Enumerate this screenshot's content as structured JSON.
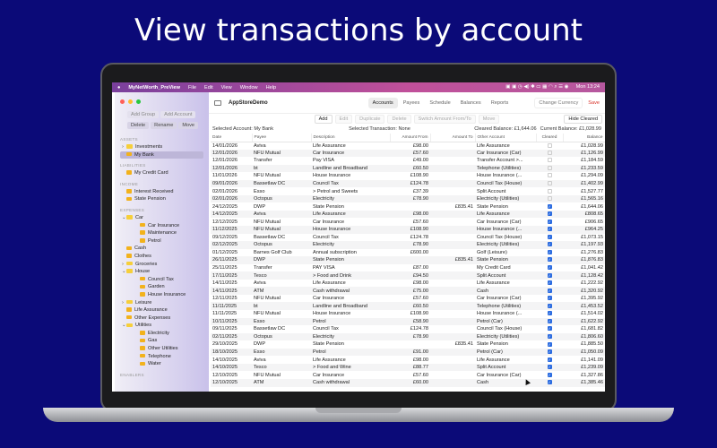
{
  "headline": "View transactions by account",
  "menubar": {
    "app": "MyNetWorth_PreView",
    "items": [
      "File",
      "Edit",
      "View",
      "Window",
      "Help"
    ],
    "clock": "Mon 13:24"
  },
  "sidebar": {
    "buttons": [
      "Add Group",
      "Add Account",
      "Delete",
      "Rename",
      "Move"
    ],
    "sections": [
      {
        "label": "ASSETS",
        "items": [
          {
            "label": "Investments",
            "type": "folder",
            "chev": ">",
            "depth": 0
          },
          {
            "label": "My Bank",
            "type": "account",
            "depth": 0,
            "selected": true
          }
        ]
      },
      {
        "label": "LIABILITIES",
        "items": [
          {
            "label": "My Credit Card",
            "type": "account",
            "depth": 0
          }
        ]
      },
      {
        "label": "INCOME",
        "items": [
          {
            "label": "Interest Received",
            "type": "account",
            "depth": 0
          },
          {
            "label": "State Pension",
            "type": "account",
            "depth": 0
          }
        ]
      },
      {
        "label": "EXPENSES",
        "items": [
          {
            "label": "Car",
            "type": "folder",
            "chev": "v",
            "depth": 0
          },
          {
            "label": "Car Insurance",
            "type": "account",
            "depth": 1
          },
          {
            "label": "Maintenance",
            "type": "account",
            "depth": 1
          },
          {
            "label": "Petrol",
            "type": "account",
            "depth": 1
          },
          {
            "label": "Cash",
            "type": "account",
            "depth": 0
          },
          {
            "label": "Clothes",
            "type": "account",
            "depth": 0
          },
          {
            "label": "Groceries",
            "type": "folder",
            "chev": ">",
            "depth": 0
          },
          {
            "label": "House",
            "type": "folder",
            "chev": "v",
            "depth": 0
          },
          {
            "label": "Council Tax",
            "type": "account",
            "depth": 1
          },
          {
            "label": "Garden",
            "type": "account",
            "depth": 1
          },
          {
            "label": "House Insurance",
            "type": "account",
            "depth": 1
          },
          {
            "label": "Leisure",
            "type": "folder",
            "chev": ">",
            "depth": 0
          },
          {
            "label": "Life Assurance",
            "type": "account",
            "depth": 0
          },
          {
            "label": "Other Expenses",
            "type": "account",
            "depth": 0
          },
          {
            "label": "Utilities",
            "type": "folder",
            "chev": "v",
            "depth": 0
          },
          {
            "label": "Electricity",
            "type": "account",
            "depth": 1
          },
          {
            "label": "Gas",
            "type": "account",
            "depth": 1
          },
          {
            "label": "Other Utilities",
            "type": "account",
            "depth": 1
          },
          {
            "label": "Telephone",
            "type": "account",
            "depth": 1
          },
          {
            "label": "Water",
            "type": "account",
            "depth": 1
          }
        ]
      },
      {
        "label": "ENABLERS",
        "items": []
      }
    ]
  },
  "toolbar": {
    "title": "AppStoreDemo",
    "tabs": [
      "Accounts",
      "Payees",
      "Schedule",
      "Balances",
      "Reports"
    ],
    "active_tab": "Accounts",
    "change_currency": "Change Currency",
    "save": "Save"
  },
  "actions": {
    "buttons": [
      "Add",
      "Edit",
      "Duplicate",
      "Delete",
      "Switch Amount From/To",
      "Move"
    ],
    "hide_cleared": "Hide Cleared"
  },
  "info": {
    "selected_account": "Selected Account:  My Bank",
    "selected_transaction": "Selected Transaction:  None",
    "cleared_balance": "Cleared Balance:  £1,644.06",
    "current_balance": "Current Balance:  £1,028.99"
  },
  "table": {
    "columns": [
      "Date",
      "Payee",
      "Description",
      "Amount From",
      "Amount To",
      "Other Account",
      "Cleared",
      "Balance"
    ],
    "rows": [
      [
        "14/01/2026",
        "Aviva",
        "Life Assurance",
        "£98.00",
        "",
        "Life Assurance",
        false,
        "£1,028.99"
      ],
      [
        "12/01/2026",
        "NFU Mutual",
        "Car Insurance",
        "£57.60",
        "",
        "Car Insurance (Car)",
        false,
        "£1,126.99"
      ],
      [
        "12/01/2026",
        "Transfer",
        "Pay VISA",
        "£49.00",
        "",
        "Transfer Account >...",
        false,
        "£1,184.59"
      ],
      [
        "12/01/2026",
        "bt",
        "Landline and Broadband",
        "£60.50",
        "",
        "Telephone (Utilities)",
        false,
        "£1,233.59"
      ],
      [
        "11/01/2026",
        "NFU Mutual",
        "House Insurance",
        "£108.90",
        "",
        "House Insurance (...",
        false,
        "£1,294.09"
      ],
      [
        "09/01/2026",
        "Bassetlaw DC",
        "Council Tax",
        "£124.78",
        "",
        "Council Tax (House)",
        false,
        "£1,402.99"
      ],
      [
        "02/01/2026",
        "Esso",
        "> Petrol and Sweets",
        "£37.39",
        "",
        "Split Account",
        false,
        "£1,527.77"
      ],
      [
        "02/01/2026",
        "Octopus",
        "Electricity",
        "£78.90",
        "",
        "Electricity (Utilities)",
        false,
        "£1,565.16"
      ],
      [
        "24/12/2025",
        "DWP",
        "State Pension",
        "",
        "£835.41",
        "State Pension",
        true,
        "£1,644.06"
      ],
      [
        "14/12/2025",
        "Aviva",
        "Life Assurance",
        "£98.00",
        "",
        "Life Assurance",
        true,
        "£808.65"
      ],
      [
        "12/12/2025",
        "NFU Mutual",
        "Car Insurance",
        "£57.60",
        "",
        "Car Insurance (Car)",
        true,
        "£906.65"
      ],
      [
        "11/12/2025",
        "NFU Mutual",
        "House Insurance",
        "£108.90",
        "",
        "House Insurance (...",
        true,
        "£964.25"
      ],
      [
        "09/12/2025",
        "Bassetlaw DC",
        "Council Tax",
        "£124.78",
        "",
        "Council Tax (House)",
        true,
        "£1,073.15"
      ],
      [
        "02/12/2025",
        "Octopus",
        "Electricity",
        "£78.90",
        "",
        "Electricity (Utilities)",
        true,
        "£1,197.93"
      ],
      [
        "01/12/2025",
        "Barnes Golf Club",
        "Annual subscription",
        "£600.00",
        "",
        "Golf (Leisure)",
        true,
        "£1,276.83"
      ],
      [
        "26/11/2025",
        "DWP",
        "State Pension",
        "",
        "£835.41",
        "State Pension",
        true,
        "£1,876.83"
      ],
      [
        "25/11/2025",
        "Transfer",
        "PAY VISA",
        "£87.00",
        "",
        "My Credit Card",
        true,
        "£1,041.42"
      ],
      [
        "17/11/2025",
        "Tesco",
        "> Food and Drink",
        "£94.50",
        "",
        "Split Account",
        true,
        "£1,128.42"
      ],
      [
        "14/11/2025",
        "Aviva",
        "Life Assurance",
        "£98.00",
        "",
        "Life Assurance",
        true,
        "£1,222.92"
      ],
      [
        "14/11/2025",
        "ATM",
        "Cash withdrawal",
        "£75.00",
        "",
        "Cash",
        true,
        "£1,320.92"
      ],
      [
        "12/11/2025",
        "NFU Mutual",
        "Car Insurance",
        "£57.60",
        "",
        "Car Insurance (Car)",
        true,
        "£1,395.92"
      ],
      [
        "11/11/2025",
        "bt",
        "Landline and Broadband",
        "£60.50",
        "",
        "Telephone (Utilities)",
        true,
        "£1,453.52"
      ],
      [
        "11/11/2025",
        "NFU Mutual",
        "House Insurance",
        "£108.90",
        "",
        "House Insurance (...",
        true,
        "£1,514.02"
      ],
      [
        "10/11/2025",
        "Esso",
        "Petrol",
        "£58.90",
        "",
        "Petrol (Car)",
        true,
        "£1,622.92"
      ],
      [
        "09/11/2025",
        "Bassetlaw DC",
        "Council Tax",
        "£124.78",
        "",
        "Council Tax (House)",
        true,
        "£1,681.82"
      ],
      [
        "02/11/2025",
        "Octopus",
        "Electricity",
        "£78.90",
        "",
        "Electricity (Utilities)",
        true,
        "£1,806.60"
      ],
      [
        "29/10/2025",
        "DWP",
        "State Pension",
        "",
        "£835.41",
        "State Pension",
        true,
        "£1,885.50"
      ],
      [
        "18/10/2025",
        "Esso",
        "Petrol",
        "£91.00",
        "",
        "Petrol (Car)",
        true,
        "£1,050.09"
      ],
      [
        "14/10/2025",
        "Aviva",
        "Life Assurance",
        "£98.00",
        "",
        "Life Assurance",
        true,
        "£1,141.09"
      ],
      [
        "14/10/2025",
        "Tesco",
        "> Food and Wine",
        "£88.77",
        "",
        "Split Account",
        true,
        "£1,239.09"
      ],
      [
        "12/10/2025",
        "NFU Mutual",
        "Car Insurance",
        "£57.60",
        "",
        "Car Insurance (Car)",
        true,
        "£1,327.86"
      ],
      [
        "12/10/2025",
        "ATM",
        "Cash withdrawal",
        "£60.00",
        "",
        "Cash",
        true,
        "£1,385.46"
      ]
    ]
  }
}
